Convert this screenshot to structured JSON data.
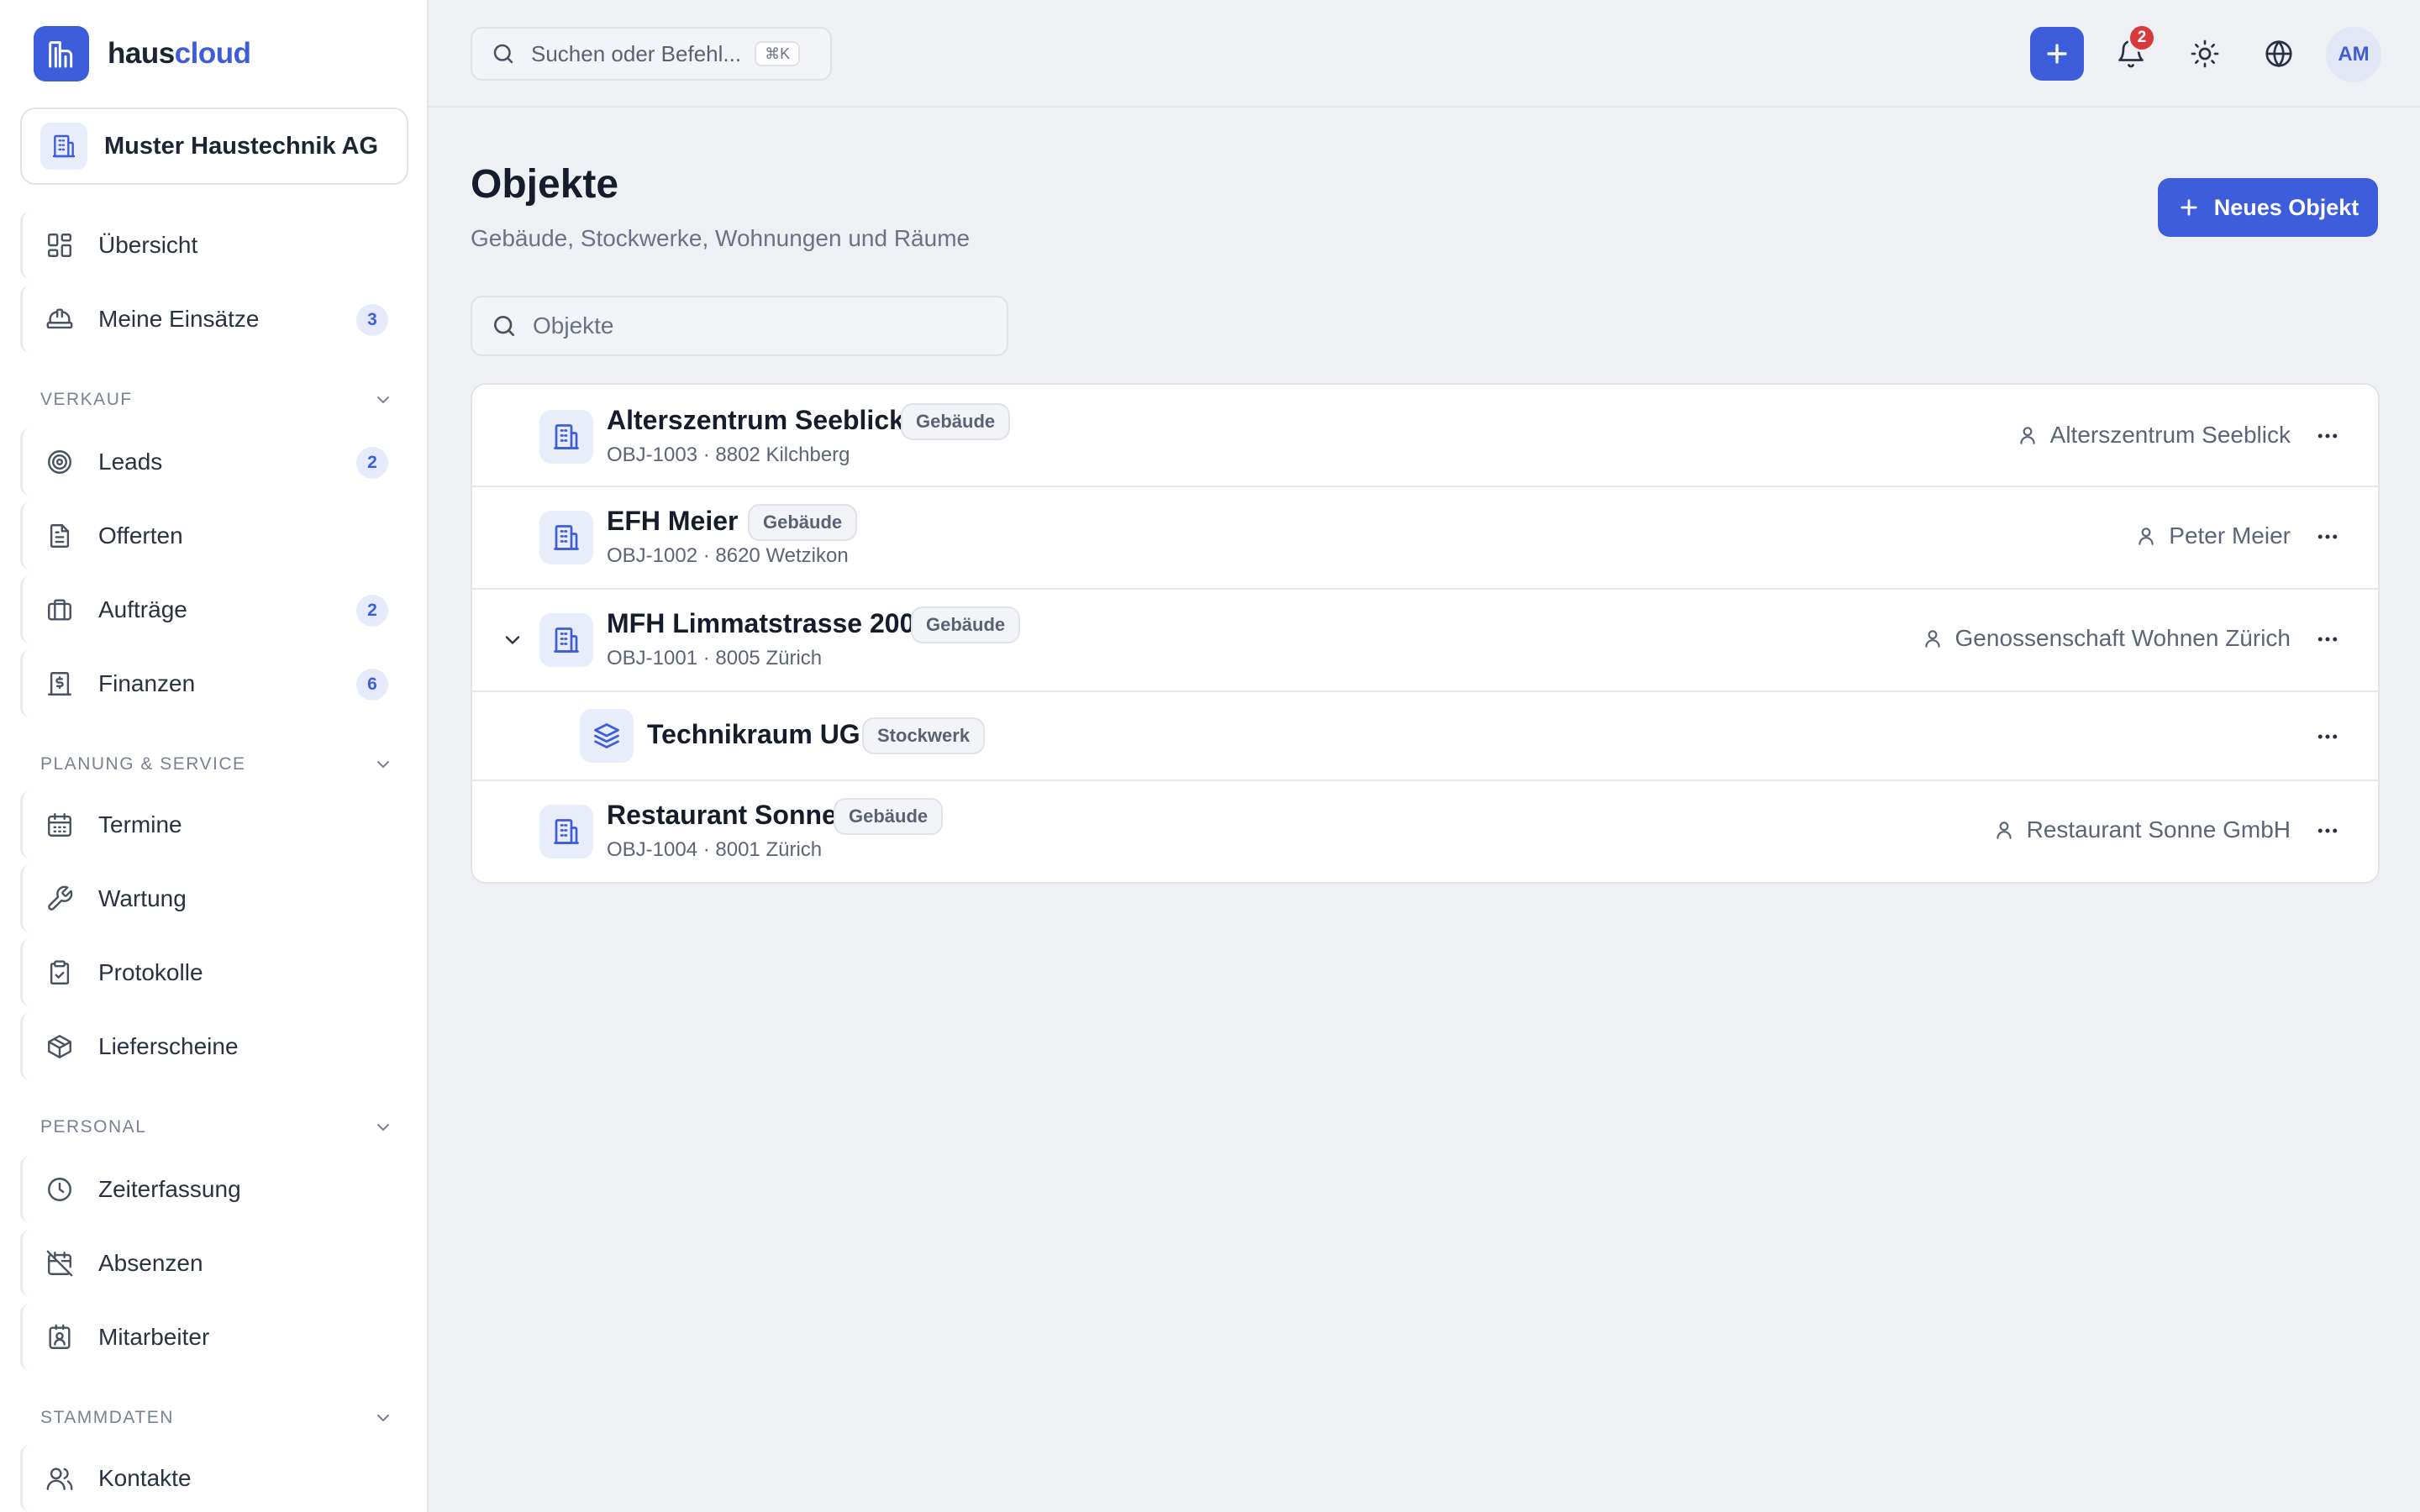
{
  "app": {
    "name_a": "haus",
    "name_b": "cloud",
    "accent": "#3d5ddb"
  },
  "org": {
    "name": "Muster Haustechnik AG"
  },
  "command": {
    "placeholder": "Suchen oder Befehl...",
    "shortcut": "⌘K"
  },
  "topbar": {
    "notifications": "2",
    "avatar": "AM"
  },
  "sidebar": {
    "top_items": [
      {
        "label": "Übersicht",
        "icon": "dashboard-icon"
      },
      {
        "label": "Meine Einsätze",
        "icon": "hardhat-icon",
        "badge": "3"
      }
    ],
    "sections": [
      {
        "title": "VERKAUF",
        "items": [
          {
            "label": "Leads",
            "icon": "target-icon",
            "badge": "2"
          },
          {
            "label": "Offerten",
            "icon": "document-icon"
          },
          {
            "label": "Aufträge",
            "icon": "briefcase-icon",
            "badge": "2"
          },
          {
            "label": "Finanzen",
            "icon": "invoice-icon",
            "badge": "6"
          }
        ]
      },
      {
        "title": "PLANUNG & SERVICE",
        "items": [
          {
            "label": "Termine",
            "icon": "calendar-icon"
          },
          {
            "label": "Wartung",
            "icon": "wrench-icon"
          },
          {
            "label": "Protokolle",
            "icon": "clipboard-check-icon"
          },
          {
            "label": "Lieferscheine",
            "icon": "package-icon"
          }
        ]
      },
      {
        "title": "PERSONAL",
        "items": [
          {
            "label": "Zeiterfassung",
            "icon": "clock-icon"
          },
          {
            "label": "Absenzen",
            "icon": "calendar-off-icon"
          },
          {
            "label": "Mitarbeiter",
            "icon": "id-badge-icon"
          }
        ]
      },
      {
        "title": "STAMMDATEN",
        "items": [
          {
            "label": "Kontakte",
            "icon": "users-icon"
          }
        ]
      }
    ]
  },
  "page": {
    "title": "Objekte",
    "subtitle": "Gebäude, Stockwerke, Wohnungen und Räume",
    "new_button": "Neues Objekt",
    "search_placeholder": "Objekte"
  },
  "objects": [
    {
      "name": "Alterszentrum Seeblick",
      "type": "Gebäude",
      "meta": "OBJ-1003 · 8802 Kilchberg",
      "owner": "Alterszentrum Seeblick"
    },
    {
      "name": "EFH Meier",
      "type": "Gebäude",
      "meta": "OBJ-1002 · 8620 Wetzikon",
      "owner": "Peter Meier"
    },
    {
      "name": "MFH Limmatstrasse 200",
      "type": "Gebäude",
      "meta": "OBJ-1001 · 8005 Zürich",
      "owner": "Genossenschaft Wohnen Zürich",
      "expanded": true
    },
    {
      "name": "Technikraum UG",
      "type": "Stockwerk",
      "child": true
    },
    {
      "name": "Restaurant Sonne",
      "type": "Gebäude",
      "meta": "OBJ-1004 · 8001 Zürich",
      "owner": "Restaurant Sonne GmbH"
    }
  ]
}
